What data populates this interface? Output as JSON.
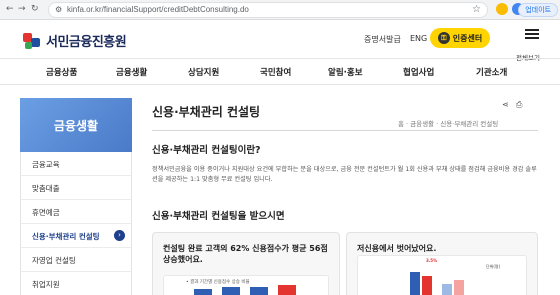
{
  "browser": {
    "url": "kinfa.or.kr/financialSupport/creditDebtConsulting.do",
    "update_label": "업데이트"
  },
  "header": {
    "logo_text": "서민금융진흥원",
    "util_links": [
      "증명서발급",
      "ENG"
    ],
    "cert_button": "인증센터",
    "menu_label": "전체보기"
  },
  "gnb": {
    "items": [
      "금융상품",
      "금융생활",
      "상담지원",
      "국민참여",
      "알림·홍보",
      "협업사업",
      "기관소개"
    ]
  },
  "sidebar": {
    "title": "금융생활",
    "items": [
      {
        "label": "금융교육",
        "active": false
      },
      {
        "label": "맞춤대출",
        "active": false
      },
      {
        "label": "휴면예금",
        "active": false
      },
      {
        "label": "신용·부채관리 컨설팅",
        "active": true
      },
      {
        "label": "자영업 컨설팅",
        "active": false
      },
      {
        "label": "취업지원",
        "active": false
      }
    ]
  },
  "main": {
    "title": "신용·부채관리 컨설팅",
    "breadcrumb": "홈 · 금융생활 · 신용·부채관리 컨설팅",
    "section1_title": "신용·부채관리 컨설팅이란?",
    "section1_body": "정책서민금융을 이용 중이거나 지원대상 요건에 부합하는 분을 대상으로, 금융 전문 컨설턴트가 월 1회 신용과 부채 상태를 점검해 금융비용 경감 솔루션을 제공하는 1:1 맞춤형 무료 컨설팅 입니다.",
    "section2_title": "신용·부채관리 컨설팅을 받으시면",
    "card1_title": "컨설팅 완료 고객의 62% 신용점수가 평균 56점 상승했어요.",
    "card1_legend": "• 결과 기간별 신용점수 상승 비율",
    "card2_title": "저신용에서 벗어났어요.",
    "card2_unit": "단위(명)",
    "card2_value": "3.5%"
  },
  "colors": {
    "accent_blue": "#1e3f8c",
    "sidebar_blue": "#5a8fd8",
    "cert_yellow": "#ffd400"
  },
  "icons": [
    "lock-icon",
    "star-icon",
    "key-icon",
    "hamburger-icon",
    "share-icon",
    "print-icon",
    "chevron-right-icon"
  ]
}
